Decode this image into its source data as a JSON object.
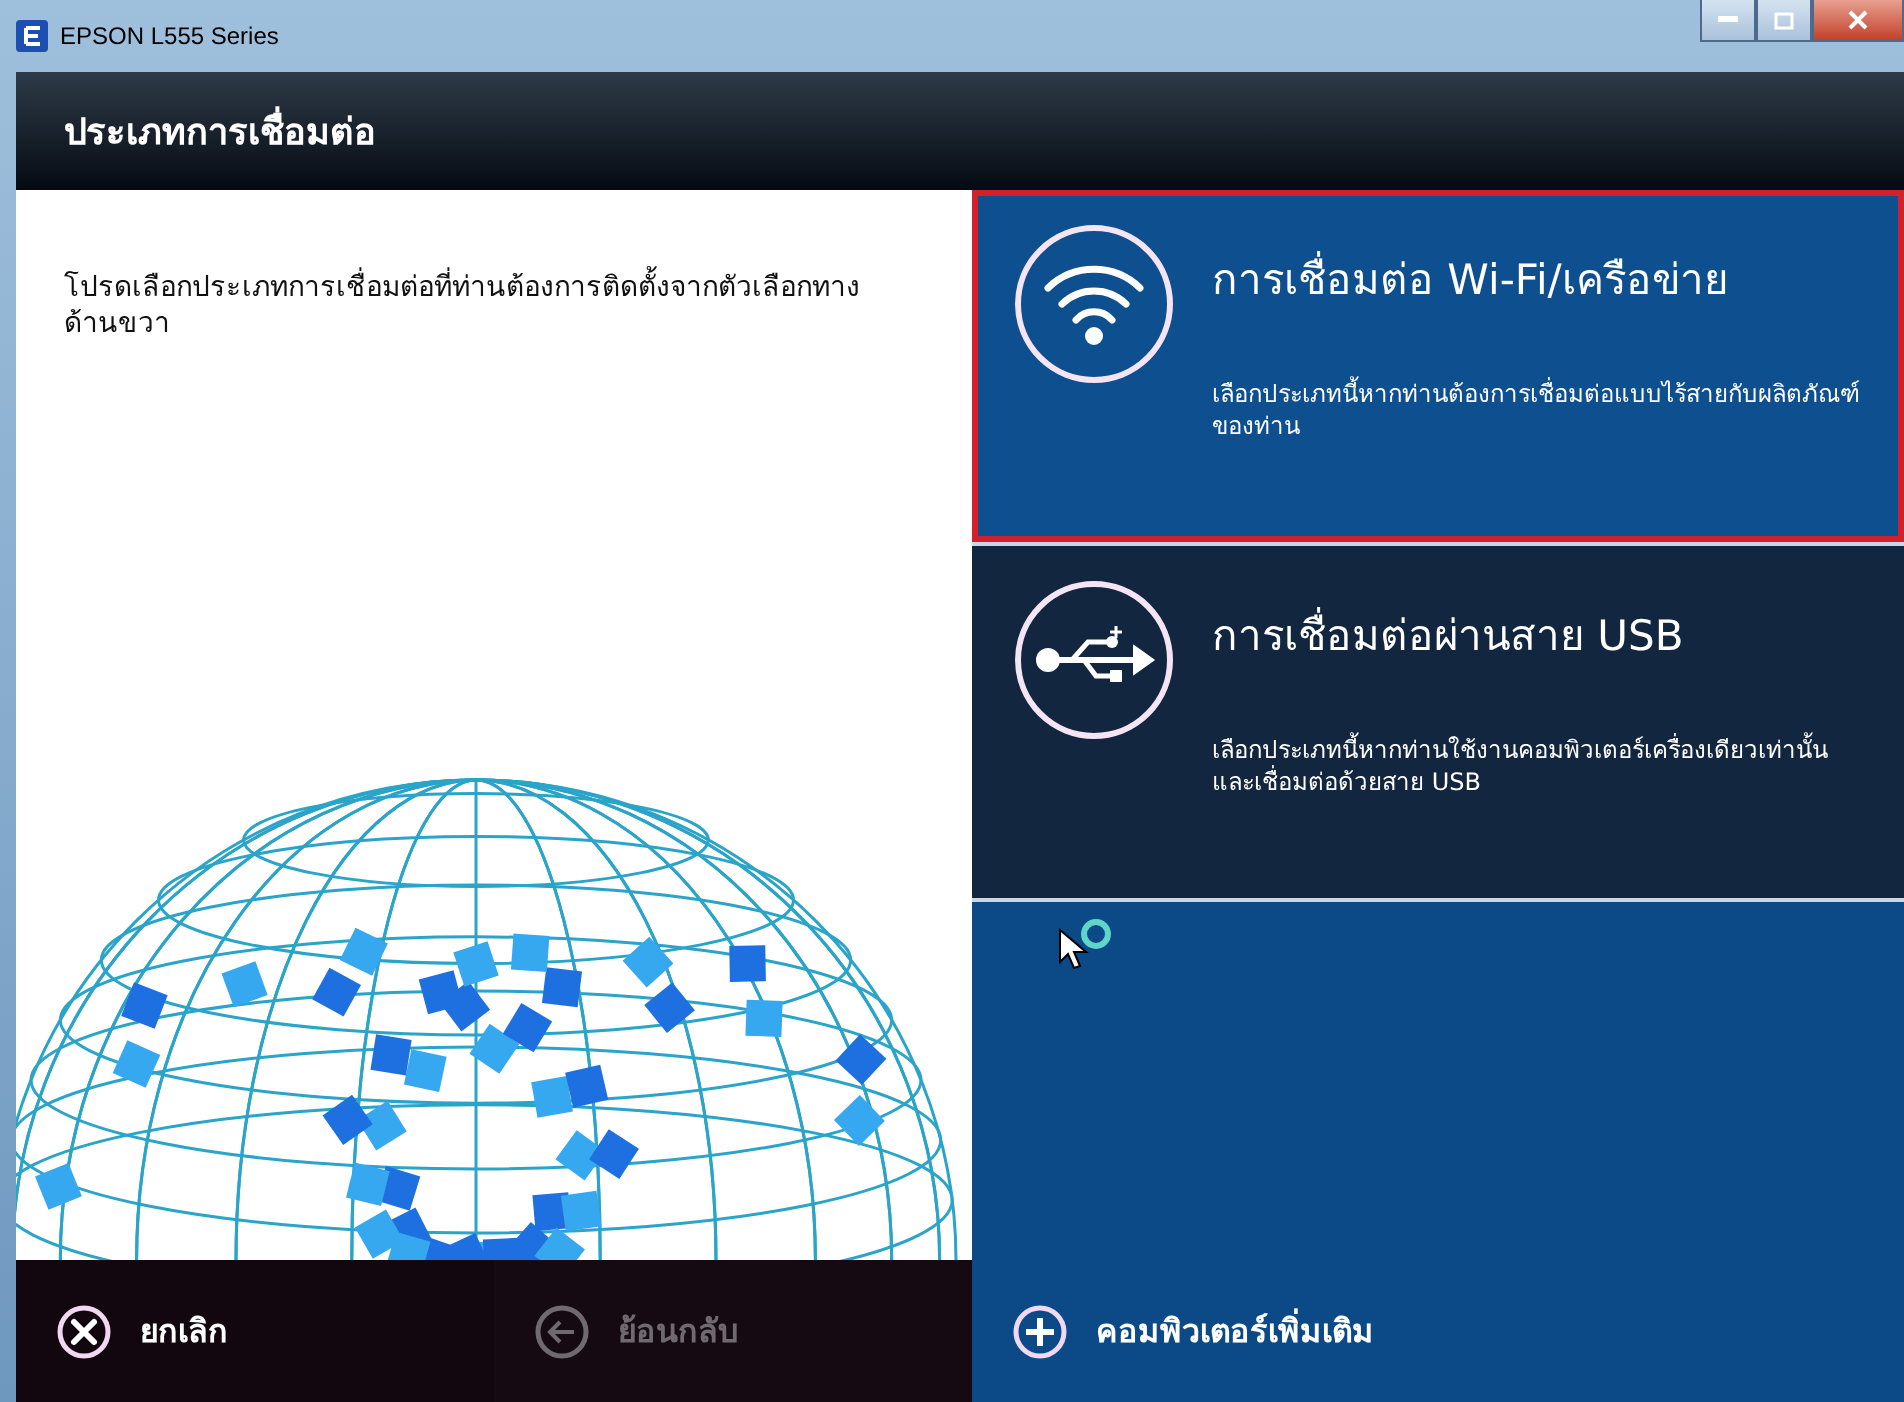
{
  "window": {
    "title": "EPSON L555 Series"
  },
  "header": {
    "title": "ประเภทการเชื่อมต่อ"
  },
  "instruction": "โปรดเลือกประเภทการเชื่อมต่อที่ท่านต้องการติดตั้งจากตัวเลือกทางด้านขวา",
  "options": [
    {
      "kind": "wifi",
      "title": "การเชื่อมต่อ Wi-Fi/เครือข่าย",
      "description": "เลือกประเภทนี้หากท่านต้องการเชื่อมต่อแบบไร้สายกับผลิตภัณฑ์ของท่าน",
      "selected": true
    },
    {
      "kind": "usb",
      "title": "การเชื่อมต่อผ่านสาย USB",
      "description": "เลือกประเภทนี้หากท่านใช้งานคอมพิวเตอร์เครื่องเดียวเท่านั้นและเชื่อมต่อด้วยสาย USB",
      "selected": false
    }
  ],
  "footer": {
    "buttons": [
      {
        "kind": "cancel",
        "label": "ยกเลิก",
        "disabled": false
      },
      {
        "kind": "back",
        "label": "ย้อนกลับ",
        "disabled": true
      }
    ],
    "add_button": {
      "label": "คอมพิวเตอร์เพิ่มเติม"
    }
  }
}
